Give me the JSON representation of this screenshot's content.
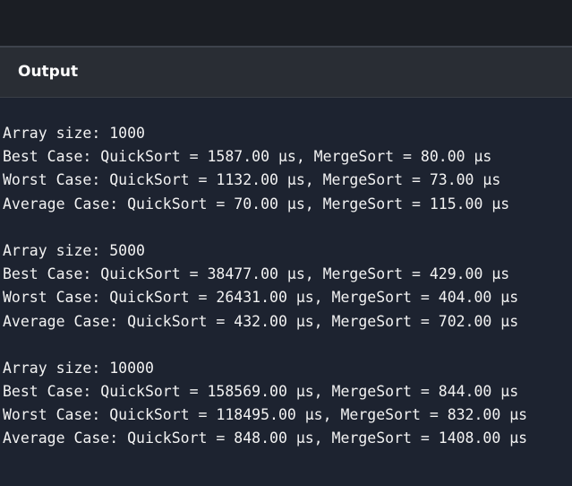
{
  "header": {
    "title": "Output"
  },
  "output": {
    "lines": [
      "Array size: 1000",
      "Best Case: QuickSort = 1587.00 µs, MergeSort = 80.00 µs",
      "Worst Case: QuickSort = 1132.00 µs, MergeSort = 73.00 µs",
      "Average Case: QuickSort = 70.00 µs, MergeSort = 115.00 µs",
      "",
      "Array size: 5000",
      "Best Case: QuickSort = 38477.00 µs, MergeSort = 429.00 µs",
      "Worst Case: QuickSort = 26431.00 µs, MergeSort = 404.00 µs",
      "Average Case: QuickSort = 432.00 µs, MergeSort = 702.00 µs",
      "",
      "Array size: 10000",
      "Best Case: QuickSort = 158569.00 µs, MergeSort = 844.00 µs",
      "Worst Case: QuickSort = 118495.00 µs, MergeSort = 832.00 µs",
      "Average Case: QuickSort = 848.00 µs, MergeSort = 1408.00 µs"
    ]
  },
  "colors": {
    "top_bar": "#1b1e24",
    "header_bg": "#292d34",
    "output_bg": "#1d2330",
    "text": "#f2f2f2"
  }
}
